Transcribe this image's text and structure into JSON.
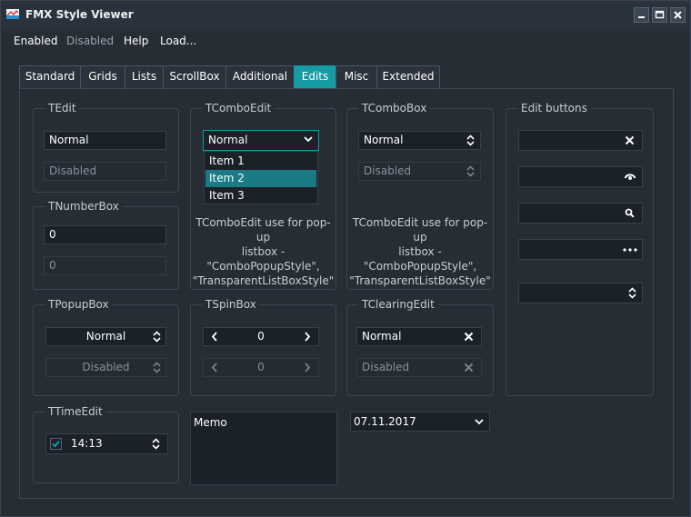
{
  "window": {
    "title": "FMX Style Viewer"
  },
  "menu": [
    "Enabled",
    "Disabled",
    "Help",
    "Load..."
  ],
  "tabs": [
    "Standard",
    "Grids",
    "Lists",
    "ScrollBox",
    "Additional",
    "Edits",
    "Misc",
    "Extended"
  ],
  "active_tab": "Edits",
  "tedit": {
    "title": "TEdit",
    "normal": "Normal",
    "disabled": "Disabled"
  },
  "tcomboedit": {
    "title": "TComboEdit",
    "value": "Normal",
    "items": [
      "Item 1",
      "Item 2",
      "Item 3"
    ],
    "selected": "Item 2",
    "note": [
      "TComboEdit use for pop-up",
      "listbox -",
      "\"ComboPopupStyle\",",
      "\"TransparentListBoxStyle\""
    ]
  },
  "tcombobox": {
    "title": "TComboBox",
    "normal": "Normal",
    "disabled": "Disabled",
    "note": [
      "TComboEdit use for pop-up",
      "listbox -",
      "\"ComboPopupStyle\",",
      "\"TransparentListBoxStyle\""
    ]
  },
  "editbuttons": {
    "title": "Edit buttons"
  },
  "tnumberbox": {
    "title": "TNumberBox",
    "normal": "0",
    "disabled": "0"
  },
  "tpopupbox": {
    "title": "TPopupBox",
    "normal": "Normal",
    "disabled": "Disabled"
  },
  "tspinbox": {
    "title": "TSpinBox",
    "normal": "0",
    "disabled": "0"
  },
  "tclearingedit": {
    "title": "TClearingEdit",
    "normal": "Normal",
    "disabled": "Disabled"
  },
  "ttimeedit": {
    "title": "TTimeEdit",
    "value": "14:13",
    "checked": true
  },
  "memo": {
    "text": "Memo"
  },
  "dateedit": {
    "value": "07.11.2017"
  },
  "colors": {
    "accent": "#169aa4",
    "selection": "#1a7b84",
    "background": "#262d35",
    "field": "#1b2128"
  }
}
